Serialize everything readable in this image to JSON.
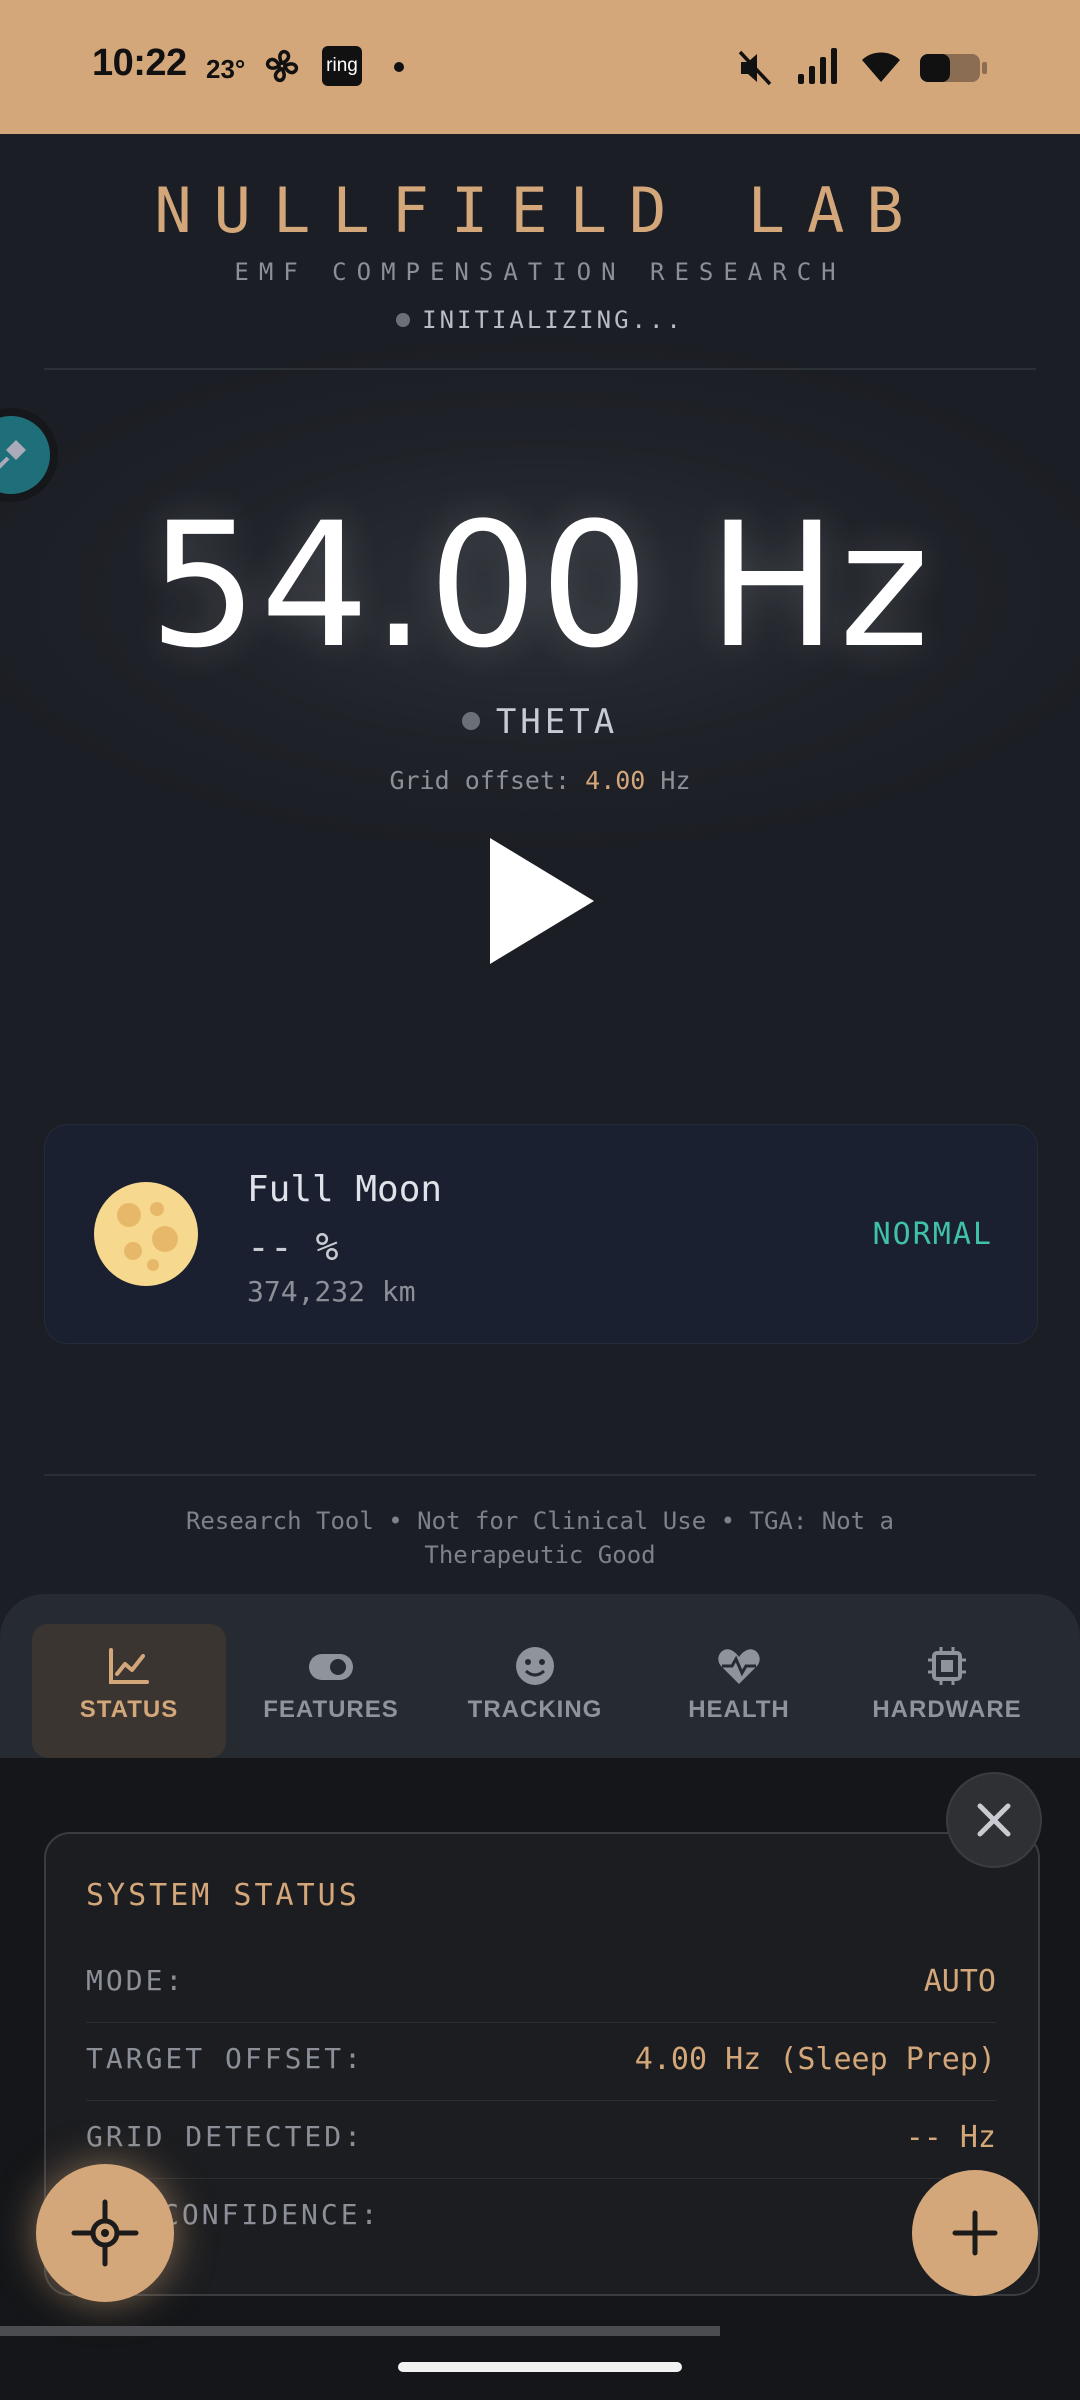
{
  "status_bar": {
    "time": "10:22",
    "temperature": "23°",
    "ring_label": "ring",
    "icons": [
      "fan-icon",
      "ring-app-icon",
      "notification-dot-icon",
      "mute-icon",
      "signal-icon",
      "wifi-icon",
      "battery-icon"
    ]
  },
  "header": {
    "title": "NULLFIELD LAB",
    "subtitle": "EMF COMPENSATION RESEARCH",
    "init_status": "INITIALIZING..."
  },
  "frequency": {
    "value": "54.00 Hz",
    "band": "THETA",
    "offset_label": "Grid offset:",
    "offset_value": "4.00",
    "offset_unit": "Hz"
  },
  "moon": {
    "phase": "Full Moon",
    "illumination": "-- %",
    "distance": "374,232 km",
    "status": "NORMAL"
  },
  "footer": {
    "disclaimer": "Research Tool • Not for Clinical Use • TGA: Not a Therapeutic Good"
  },
  "tabs": [
    {
      "label": "STATUS",
      "icon": "chart-line-icon",
      "active": true
    },
    {
      "label": "FEATURES",
      "icon": "toggle-icon",
      "active": false
    },
    {
      "label": "TRACKING",
      "icon": "smiley-icon",
      "active": false
    },
    {
      "label": "HEALTH",
      "icon": "heartbeat-icon",
      "active": false
    },
    {
      "label": "HARDWARE",
      "icon": "chip-icon",
      "active": false
    }
  ],
  "system_status": {
    "title": "SYSTEM STATUS",
    "rows": [
      {
        "label": "MODE:",
        "value": "AUTO"
      },
      {
        "label": "TARGET OFFSET:",
        "value": "4.00 Hz (Sleep Prep)"
      },
      {
        "label": "GRID DETECTED:",
        "value": "-- Hz"
      },
      {
        "label": "CONFIDENCE:",
        "value": ""
      }
    ]
  },
  "colors": {
    "accent": "#d4a77a",
    "background": "#1b1e24",
    "teal": "#3fc2a8",
    "pin_fab": "#1f6f7a"
  }
}
